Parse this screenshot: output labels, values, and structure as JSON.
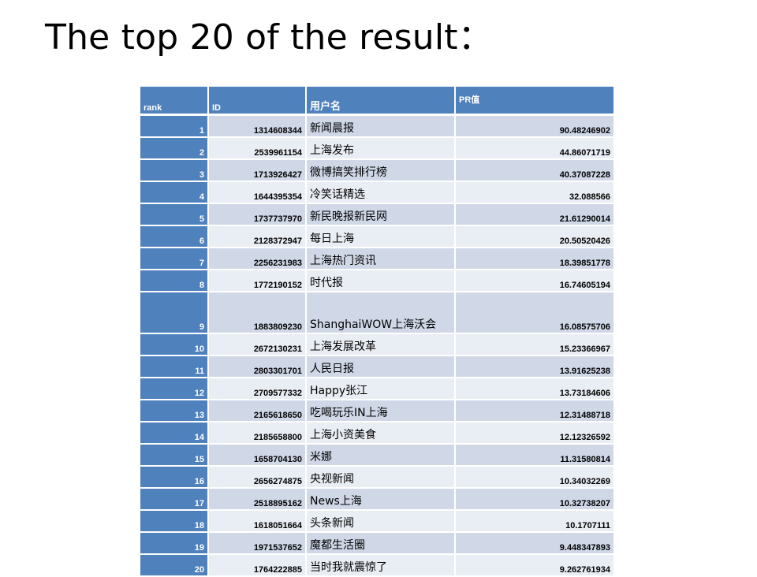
{
  "slide": {
    "title": "The top 20 of the result："
  },
  "table": {
    "headers": {
      "rank": "rank",
      "id": "ID",
      "name": "用户名",
      "pr": "PR值"
    },
    "rows": [
      {
        "rank": "1",
        "id": "1314608344",
        "name": "新闻晨报",
        "pr": "90.48246902"
      },
      {
        "rank": "2",
        "id": "2539961154",
        "name": "上海发布",
        "pr": "44.86071719"
      },
      {
        "rank": "3",
        "id": "1713926427",
        "name": "微博搞笑排行榜",
        "pr": "40.37087228"
      },
      {
        "rank": "4",
        "id": "1644395354",
        "name": "冷笑话精选",
        "pr": "32.088566"
      },
      {
        "rank": "5",
        "id": "1737737970",
        "name": "新民晚报新民网",
        "pr": "21.61290014"
      },
      {
        "rank": "6",
        "id": "2128372947",
        "name": "每日上海",
        "pr": "20.50520426"
      },
      {
        "rank": "7",
        "id": "2256231983",
        "name": "上海热门资讯",
        "pr": "18.39851778"
      },
      {
        "rank": "8",
        "id": "1772190152",
        "name": "时代报",
        "pr": "16.74605194"
      },
      {
        "rank": "9",
        "id": "1883809230",
        "name": "ShanghaiWOW上海沃会",
        "pr": "16.08575706"
      },
      {
        "rank": "10",
        "id": "2672130231",
        "name": "上海发展改革",
        "pr": "15.23366967"
      },
      {
        "rank": "11",
        "id": "2803301701",
        "name": "人民日报",
        "pr": "13.91625238"
      },
      {
        "rank": "12",
        "id": "2709577332",
        "name": "Happy张江",
        "pr": "13.73184606"
      },
      {
        "rank": "13",
        "id": "2165618650",
        "name": "吃喝玩乐IN上海",
        "pr": "12.31488718"
      },
      {
        "rank": "14",
        "id": "2185658800",
        "name": "上海小资美食",
        "pr": "12.12326592"
      },
      {
        "rank": "15",
        "id": "1658704130",
        "name": "米娜",
        "pr": "11.31580814"
      },
      {
        "rank": "16",
        "id": "2656274875",
        "name": "央视新闻",
        "pr": "10.34032269"
      },
      {
        "rank": "17",
        "id": "2518895162",
        "name": "News上海",
        "pr": "10.32738207"
      },
      {
        "rank": "18",
        "id": "1618051664",
        "name": "头条新闻",
        "pr": "10.1707111"
      },
      {
        "rank": "19",
        "id": "1971537652",
        "name": "魔都生活圈",
        "pr": "9.448347893"
      },
      {
        "rank": "20",
        "id": "1764222885",
        "name": "当时我就震惊了",
        "pr": "9.262761934"
      }
    ]
  },
  "colors": {
    "header_bg": "#4f81bd",
    "header_text": "#ffffff",
    "row_band_dark": "#d0d8e8",
    "row_band_light": "#e9edf4"
  }
}
